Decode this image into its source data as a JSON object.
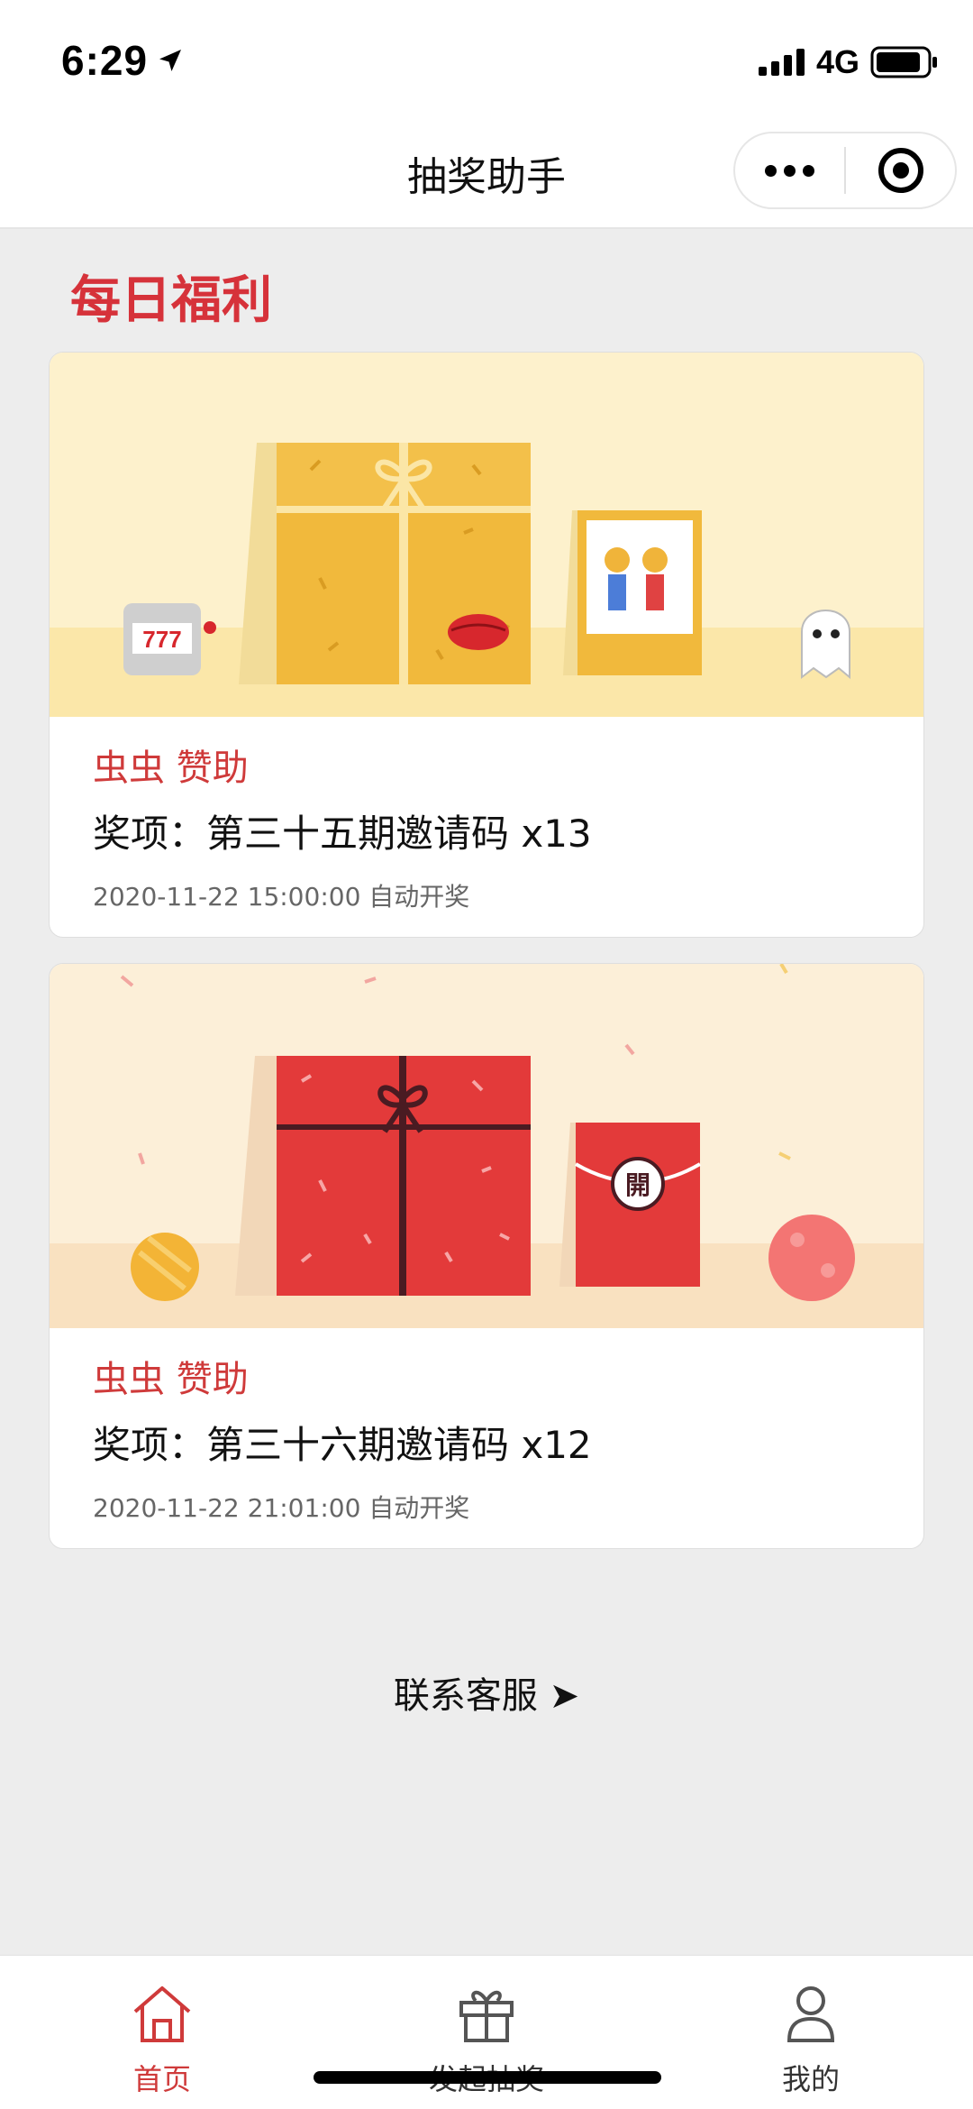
{
  "status_bar": {
    "time": "6:29",
    "network": "4G"
  },
  "nav": {
    "title": "抽奖助手"
  },
  "section": {
    "title": "每日福利"
  },
  "cards": [
    {
      "sponsor": "虫虫 赞助",
      "prize": "奖项：第三十五期邀请码 x13",
      "draw_time": "2020-11-22 15:00:00 自动开奖"
    },
    {
      "sponsor": "虫虫 赞助",
      "prize": "奖项：第三十六期邀请码 x12",
      "draw_time": "2020-11-22 21:01:00 自动开奖"
    }
  ],
  "contact": {
    "label": "联系客服 ➤"
  },
  "tabs": [
    {
      "label": "首页",
      "icon": "home-icon"
    },
    {
      "label": "发起抽奖",
      "icon": "gift-icon"
    },
    {
      "label": "我的",
      "icon": "user-icon"
    }
  ],
  "colors": {
    "accent": "#d6323a",
    "background": "#ededed"
  }
}
